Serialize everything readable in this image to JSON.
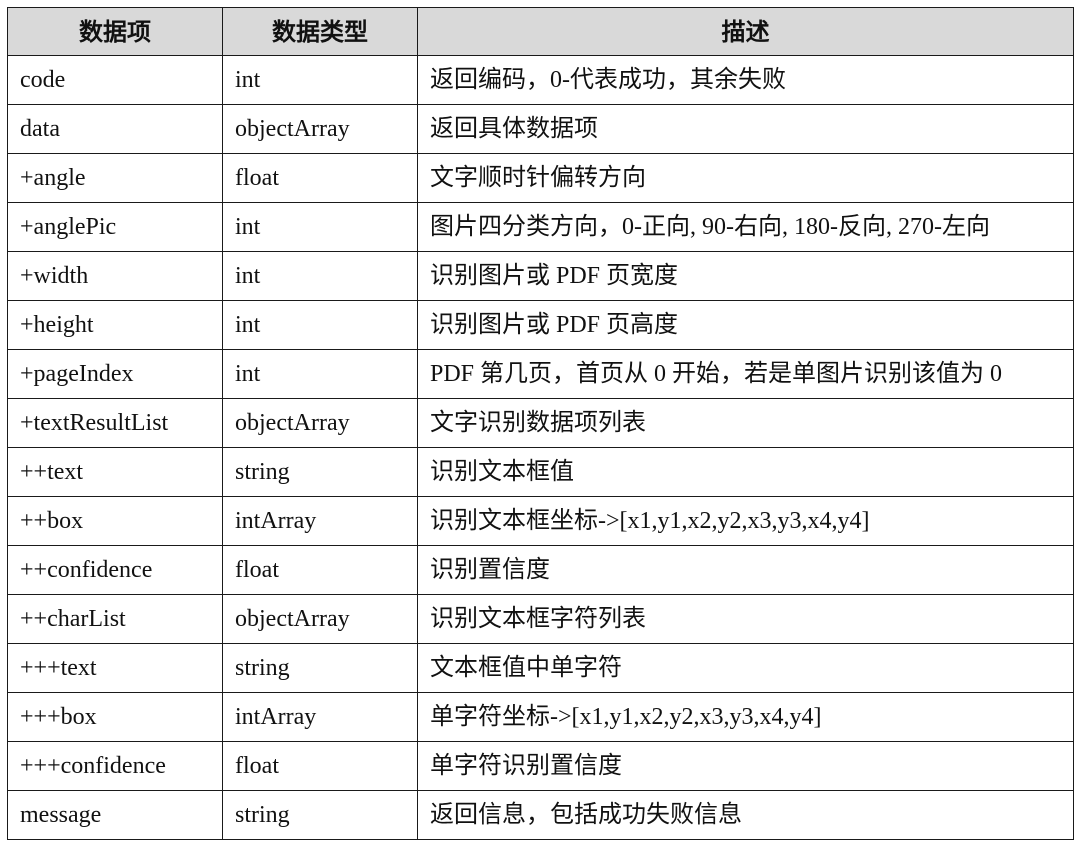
{
  "table": {
    "headers": [
      "数据项",
      "数据类型",
      "描述"
    ],
    "rows": [
      {
        "item": "code",
        "type": "int",
        "desc": "返回编码，0-代表成功，其余失败"
      },
      {
        "item": "data",
        "type": "objectArray",
        "desc": "返回具体数据项"
      },
      {
        "item": "+angle",
        "type": "float",
        "desc": "文字顺时针偏转方向"
      },
      {
        "item": "+anglePic",
        "type": "int",
        "desc": "图片四分类方向，0-正向, 90-右向, 180-反向, 270-左向"
      },
      {
        "item": "+width",
        "type": "int",
        "desc": "识别图片或 PDF 页宽度"
      },
      {
        "item": "+height",
        "type": "int",
        "desc": "识别图片或 PDF 页高度"
      },
      {
        "item": "+pageIndex",
        "type": "int",
        "desc": "PDF 第几页，首页从 0 开始，若是单图片识别该值为 0"
      },
      {
        "item": "+textResultList",
        "type": "objectArray",
        "desc": "文字识别数据项列表"
      },
      {
        "item": "++text",
        "type": "string",
        "desc": "识别文本框值"
      },
      {
        "item": "++box",
        "type": "intArray",
        "desc": "识别文本框坐标->[x1,y1,x2,y2,x3,y3,x4,y4]"
      },
      {
        "item": "++confidence",
        "type": "float",
        "desc": "识别置信度"
      },
      {
        "item": "++charList",
        "type": "objectArray",
        "desc": "识别文本框字符列表"
      },
      {
        "item": "+++text",
        "type": "string",
        "desc": "文本框值中单字符"
      },
      {
        "item": "+++box",
        "type": "intArray",
        "desc": "单字符坐标->[x1,y1,x2,y2,x3,y3,x4,y4]"
      },
      {
        "item": "+++confidence",
        "type": "float",
        "desc": "单字符识别置信度"
      },
      {
        "item": "message",
        "type": "string",
        "desc": "返回信息，包括成功失败信息"
      }
    ]
  },
  "colors": {
    "header_bg": "#d9d9d9",
    "border": "#1a1a1a"
  }
}
